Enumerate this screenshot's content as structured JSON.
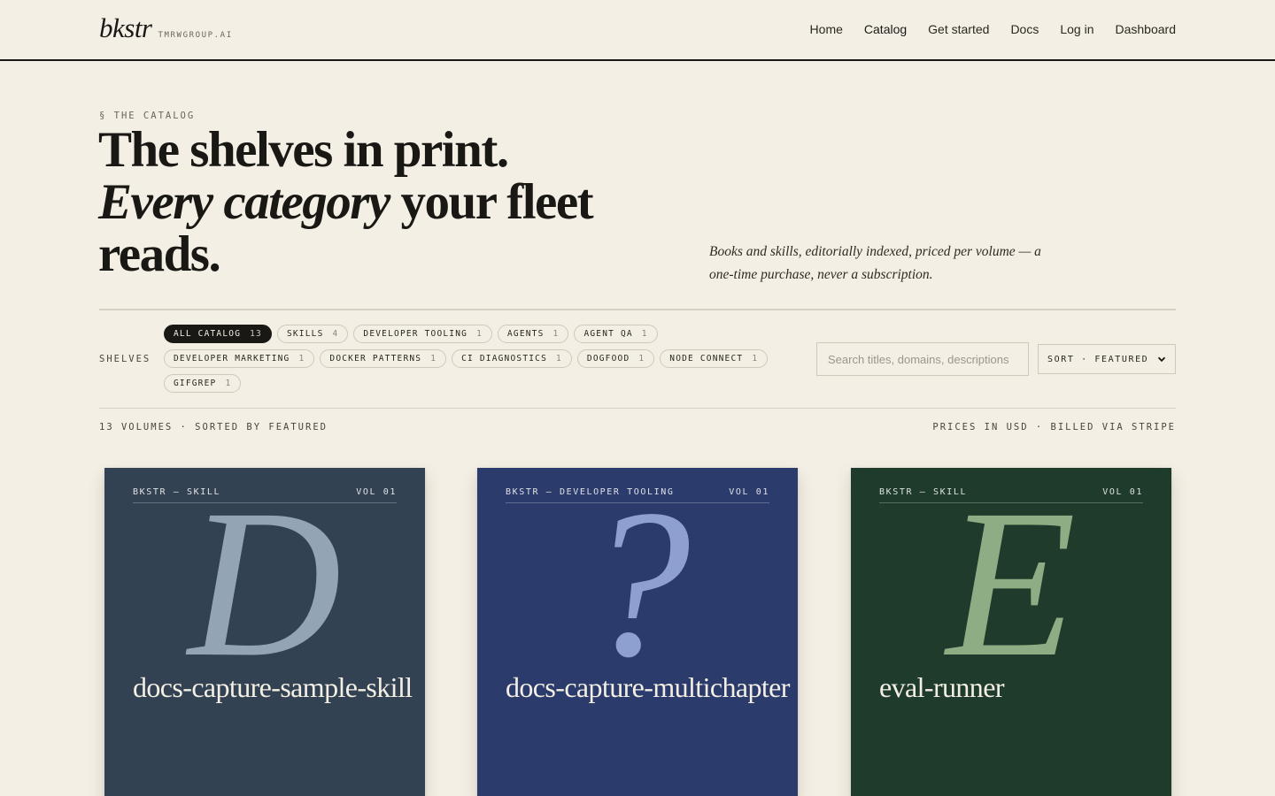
{
  "brand": {
    "logo": "bkstr",
    "org": "TMRWGROUP.AI"
  },
  "nav": [
    {
      "label": "Home",
      "active": false
    },
    {
      "label": "Catalog",
      "active": true
    },
    {
      "label": "Get started",
      "active": false
    },
    {
      "label": "Docs",
      "active": false
    },
    {
      "label": "Log in",
      "active": false
    },
    {
      "label": "Dashboard",
      "active": false
    }
  ],
  "hero": {
    "eyebrow": "§ THE CATALOG",
    "line1": "The shelves in print.",
    "line2_italic": "Every category",
    "line2_rest": " your fleet reads.",
    "blurb": "Books and skills, editorially indexed, priced per volume — a one-time purchase, never a subscription."
  },
  "filters": {
    "shelves_label": "SHELVES",
    "chips": [
      {
        "label": "ALL CATALOG",
        "count": "13",
        "active": true
      },
      {
        "label": "SKILLS",
        "count": "4",
        "active": false
      },
      {
        "label": "DEVELOPER TOOLING",
        "count": "1",
        "active": false
      },
      {
        "label": "AGENTS",
        "count": "1",
        "active": false
      },
      {
        "label": "AGENT QA",
        "count": "1",
        "active": false
      },
      {
        "label": "DEVELOPER MARKETING",
        "count": "1",
        "active": false
      },
      {
        "label": "DOCKER PATTERNS",
        "count": "1",
        "active": false
      },
      {
        "label": "CI DIAGNOSTICS",
        "count": "1",
        "active": false
      },
      {
        "label": "DOGFOOD",
        "count": "1",
        "active": false
      },
      {
        "label": "NODE CONNECT",
        "count": "1",
        "active": false
      },
      {
        "label": "GIFGREP",
        "count": "1",
        "active": false
      }
    ],
    "search_placeholder": "Search titles, domains, descriptions",
    "search_value": "",
    "sort_label": "SORT · FEATURED"
  },
  "results": {
    "summary": "13 VOLUMES · SORTED BY FEATURED",
    "pricing_note": "PRICES IN USD · BILLED VIA STRIPE"
  },
  "books": [
    {
      "publisher": "BKSTR — SKILL",
      "volume": "VOL 01",
      "glyph": "D",
      "title": "docs-capture-sample-skill",
      "bg": "#334252",
      "glyph_color": "#93a4b4"
    },
    {
      "publisher": "BKSTR — DEVELOPER TOOLING",
      "volume": "VOL 01",
      "glyph": "?",
      "title": "docs-capture-multichapter",
      "bg": "#2b3b6b",
      "glyph_color": "#8da0d0"
    },
    {
      "publisher": "BKSTR — SKILL",
      "volume": "VOL 01",
      "glyph": "E",
      "title": "eval-runner",
      "bg": "#1f3b2b",
      "glyph_color": "#8fad84"
    }
  ]
}
